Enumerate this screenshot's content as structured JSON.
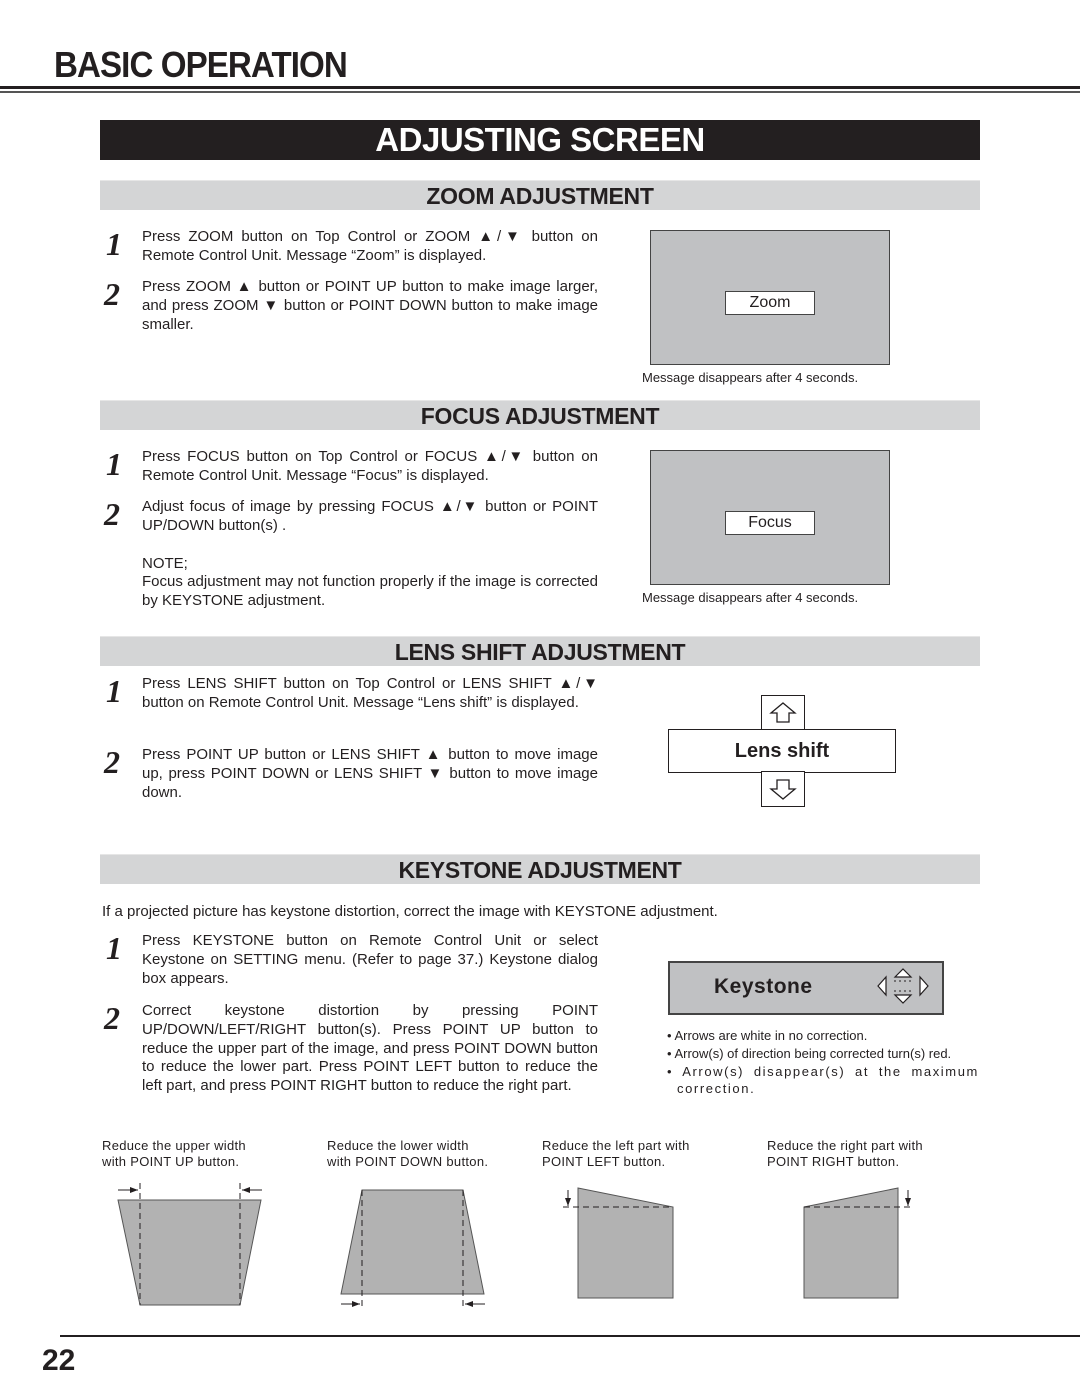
{
  "page": {
    "header": "BASIC OPERATION",
    "banner": "ADJUSTING SCREEN",
    "page_number": "22"
  },
  "zoom": {
    "title": "ZOOM ADJUSTMENT",
    "steps": [
      {
        "num": "1",
        "text": "Press ZOOM button on Top Control or ZOOM ▲/▼ button on Remote Control Unit.  Message “Zoom” is displayed."
      },
      {
        "num": "2",
        "text": "Press ZOOM ▲ button or POINT UP button to make image larger, and press ZOOM ▼ button or POINT DOWN button to make image smaller."
      }
    ],
    "osd_label": "Zoom",
    "caption": "Message disappears after 4 seconds."
  },
  "focus": {
    "title": "FOCUS ADJUSTMENT",
    "steps": [
      {
        "num": "1",
        "text": "Press FOCUS button on Top Control or FOCUS ▲/▼ button on Remote Control Unit.  Message “Focus” is displayed."
      },
      {
        "num": "2",
        "text": "Adjust focus of image by pressing FOCUS ▲/▼  button or POINT UP/DOWN button(s) ."
      }
    ],
    "note_label": "NOTE;",
    "note_text": "Focus adjustment may not function properly if the image is corrected by KEYSTONE adjustment.",
    "osd_label": "Focus",
    "caption": "Message disappears after 4 seconds."
  },
  "lens_shift": {
    "title": "LENS SHIFT ADJUSTMENT",
    "steps": [
      {
        "num": "1",
        "text": "Press LENS SHIFT button on Top Control or LENS SHIFT ▲/▼ button on Remote Control Unit. Message “Lens shift” is displayed."
      },
      {
        "num": "2",
        "text": "Press POINT UP button or LENS SHIFT ▲ button to move image up, press POINT DOWN or LENS SHIFT ▼ button to move image down."
      }
    ],
    "osd_label": "Lens shift",
    "icons": {
      "up": "up-arrow-icon",
      "down": "down-arrow-icon"
    }
  },
  "keystone": {
    "title": "KEYSTONE ADJUSTMENT",
    "intro": "If a projected picture has keystone distortion, correct the image with KEYSTONE adjustment.",
    "steps": [
      {
        "num": "1",
        "text": "Press KEYSTONE button on Remote Control Unit or select Keystone on SETTING menu.  (Refer to page 37.)  Keystone dialog box appears."
      },
      {
        "num": "2",
        "text": "Correct keystone distortion by pressing POINT UP/DOWN/LEFT/RIGHT button(s).  Press POINT UP button to reduce the upper part of the image, and press POINT DOWN button to reduce the lower part.  Press POINT LEFT button to reduce the left part, and press POINT RIGHT button to reduce the right part."
      }
    ],
    "osd_label": "Keystone",
    "bullets": [
      "Arrows are white in no correction.",
      "Arrow(s) of direction being corrected turn(s) red.",
      "Arrow(s) disappear(s) at the maximum correction."
    ],
    "diagrams": [
      {
        "line1": "Reduce the upper width",
        "line2": "with POINT UP button."
      },
      {
        "line1": "Reduce the lower width",
        "line2": "with POINT DOWN button."
      },
      {
        "line1": "Reduce the left part with",
        "line2": "POINT LEFT button."
      },
      {
        "line1": "Reduce the right part with",
        "line2": "POINT RIGHT button."
      }
    ]
  },
  "colors": {
    "screen_gray": "#c0c1c3",
    "diagram_gray": "#b2b2b2",
    "section_bar": "#d4d5d6",
    "banner": "#231f20"
  }
}
